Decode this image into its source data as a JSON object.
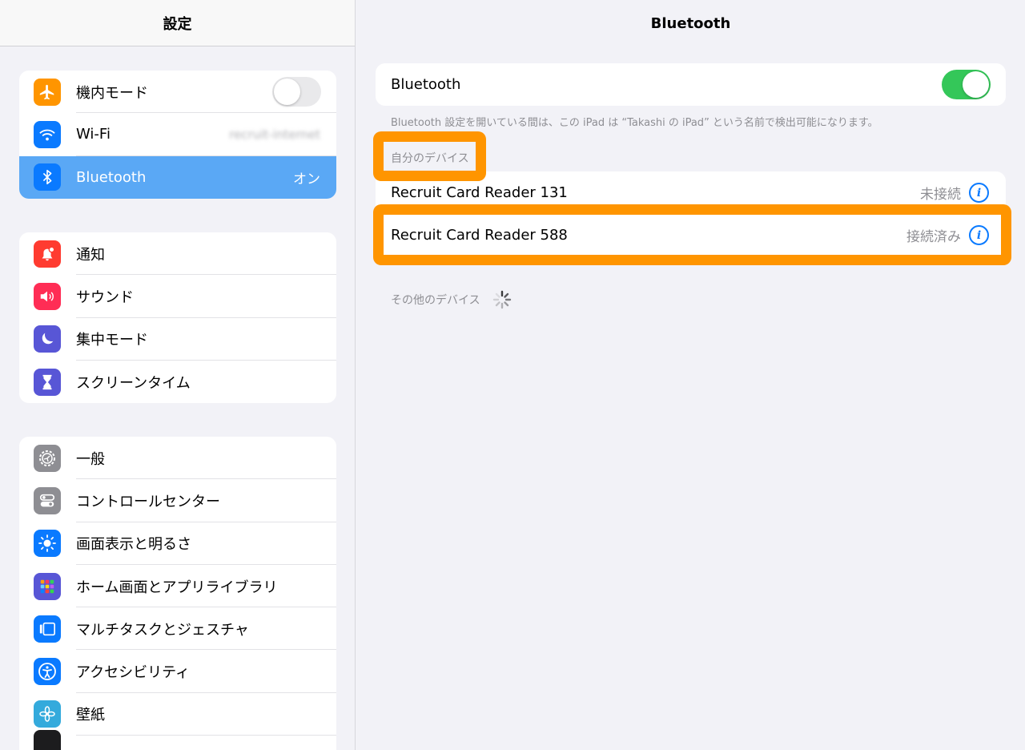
{
  "sidebar": {
    "title": "設定",
    "group1": [
      {
        "label": "機内モード",
        "icon": "airplane-icon",
        "color": "#ff9500",
        "toggle": "off"
      },
      {
        "label": "Wi-Fi",
        "icon": "wifi-icon",
        "color": "#0a7aff",
        "value": "recruit-internet"
      },
      {
        "label": "Bluetooth",
        "icon": "bluetooth-icon",
        "color": "#0a7aff",
        "value": "オン",
        "selected": true
      }
    ],
    "group2": [
      {
        "label": "通知",
        "icon": "bell-icon",
        "color": "#ff3b30"
      },
      {
        "label": "サウンド",
        "icon": "speaker-icon",
        "color": "#ff2d55"
      },
      {
        "label": "集中モード",
        "icon": "moon-icon",
        "color": "#5856d6"
      },
      {
        "label": "スクリーンタイム",
        "icon": "hourglass-icon",
        "color": "#5856d6"
      }
    ],
    "group3": [
      {
        "label": "一般",
        "icon": "gear-icon",
        "color": "#8e8e93"
      },
      {
        "label": "コントロールセンター",
        "icon": "switches-icon",
        "color": "#8e8e93"
      },
      {
        "label": "画面表示と明るさ",
        "icon": "sun-icon",
        "color": "#0a7aff"
      },
      {
        "label": "ホーム画面とアプリライブラリ",
        "icon": "app-grid-icon",
        "color": "#5856d6"
      },
      {
        "label": "マルチタスクとジェスチャ",
        "icon": "multitask-icon",
        "color": "#0a7aff"
      },
      {
        "label": "アクセシビリティ",
        "icon": "accessibility-icon",
        "color": "#0a7aff"
      },
      {
        "label": "壁紙",
        "icon": "flower-icon",
        "color": "#34aadc"
      }
    ]
  },
  "detail": {
    "title": "Bluetooth",
    "bluetooth_label": "Bluetooth",
    "bluetooth_state": "on",
    "footnote": "Bluetooth 設定を開いている間は、この iPad は “Takashi の iPad” という名前で検出可能になります。",
    "my_devices_header": "自分のデバイス",
    "devices": [
      {
        "name": "Recruit Card Reader 131",
        "status": "未接続"
      },
      {
        "name": "Recruit Card Reader 588",
        "status": "接続済み"
      }
    ],
    "other_devices_header": "その他のデバイス",
    "highlight_color": "#ff9500"
  }
}
